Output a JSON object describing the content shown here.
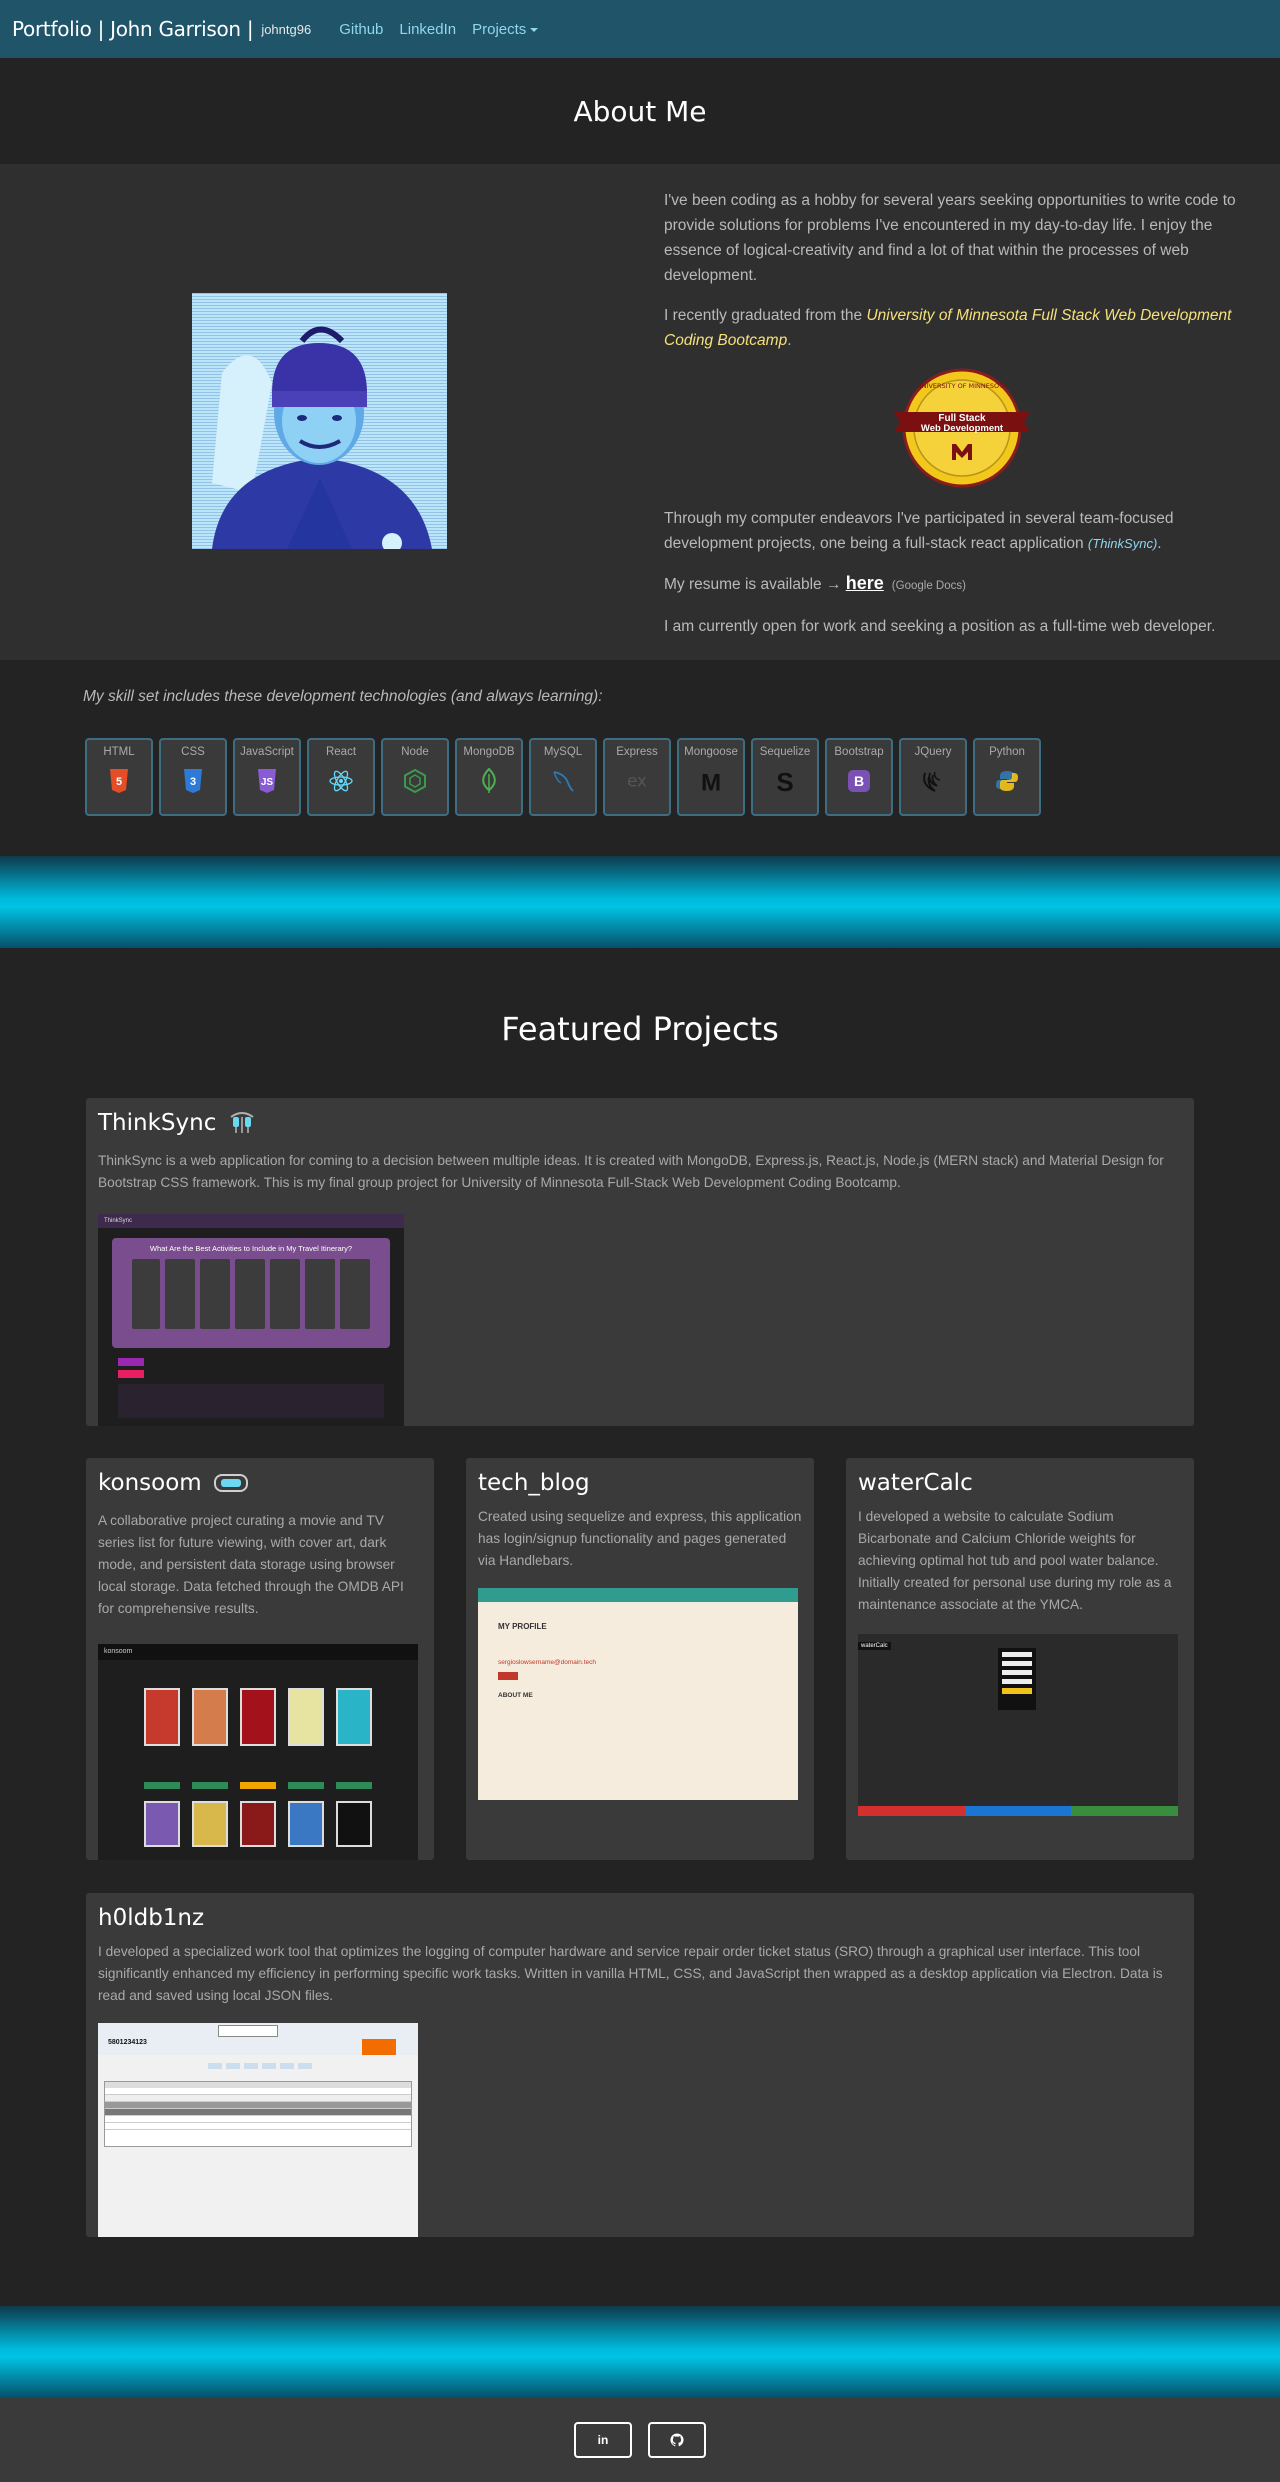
{
  "nav": {
    "brand": "Portfolio | John Garrison |",
    "handle": "johntg96",
    "links": [
      "Github",
      "LinkedIn",
      "Projects"
    ]
  },
  "about": {
    "heading": "About Me",
    "p1": "I've been coding as a hobby for several years seeking opportunities to write code to provide solutions for problems I've encountered in my day-to-day life. I enjoy the essence of logical-creativity and find a lot of that within the processes of web development.",
    "p2_prefix": "I recently graduated from the ",
    "p2_link": "University of Minnesota Full Stack Web Development Coding Bootcamp",
    "p2_suffix": ".",
    "badge": {
      "top": "UNIVERSITY OF MINNESOTA",
      "line1": "Full Stack",
      "line2": "Web Development"
    },
    "p3_prefix": "Through my computer endeavors I've participated in several team-focused development projects, one being a full-stack react application ",
    "p3_link": "(ThinkSync)",
    "p3_suffix": ".",
    "resume_prefix": "My resume is available → ",
    "resume_link": "here",
    "resume_note": "(Google Docs)",
    "p5": "I am currently open for work and seeking a position as a full-time web developer."
  },
  "skills": {
    "intro": "My skill set includes these development technologies (and always learning):",
    "items": [
      "HTML",
      "CSS",
      "JavaScript",
      "React",
      "Node",
      "MongoDB",
      "MySQL",
      "Express",
      "Mongoose",
      "Sequelize",
      "Bootstrap",
      "JQuery",
      "Python"
    ]
  },
  "featured": {
    "heading": "Featured Projects",
    "thinksync": {
      "title": "ThinkSync",
      "desc": "ThinkSync is a web application for coming to a decision between multiple ideas. It is created with MongoDB, Express.js, React.js, Node.js (MERN stack) and Material Design for Bootstrap CSS framework. This is my final group project for University of Minnesota Full-Stack Web Development Coding Bootcamp.",
      "shot_title": "What Are the Best Activities to Include in My Travel Itinerary?",
      "shot_brand": "ThinkSync"
    },
    "konsoom": {
      "title": "konsoom",
      "desc": "A collaborative project curating a movie and TV series list for future viewing, with cover art, dark mode, and persistent data storage using browser local storage. Data fetched through the OMDB API for comprehensive results.",
      "shot_brand": "konsoom"
    },
    "techblog": {
      "title": "tech_blog",
      "desc": "Created using sequelize and express, this application has login/signup functionality and pages generated via Handlebars.",
      "shot_heading": "MY PROFILE",
      "shot_email": "sergioslowsername@domain.tech",
      "shot_about": "ABOUT ME"
    },
    "watercalc": {
      "title": "waterCalc",
      "desc": "I developed a website to calculate Sodium Bicarbonate and Calcium Chloride weights for achieving optimal hot tub and pool water balance. Initially created for personal use during my role as a maintenance associate at the YMCA.",
      "shot_brand": "waterCalc"
    },
    "holdbinz": {
      "title": "h0ldb1nz",
      "desc": "I developed a specialized work tool that optimizes the logging of computer hardware and service repair order ticket status (SRO) through a graphical user interface. This tool significantly enhanced my efficiency in performing specific work tasks. Written in vanilla HTML, CSS, and JavaScript then wrapped as a desktop application via Electron. Data is read and saved using local JSON files.",
      "shot_number": "5801234123"
    }
  },
  "footer": {
    "linkedin": "in",
    "github": "github"
  },
  "colors": {
    "nav_bg": "#1f5469",
    "accent_link": "#8fd6ee",
    "band_cyan": "#00c4e4",
    "card_bg": "#3a3a3a",
    "page_bg": "#232323"
  }
}
